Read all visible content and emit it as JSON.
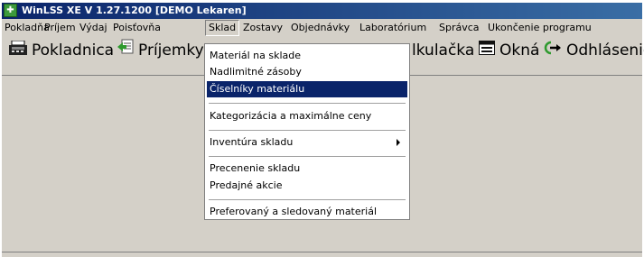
{
  "window": {
    "title": "WinLSS XE V 1.27.1200  [DEMO Lekaren]"
  },
  "menubar": {
    "items": [
      {
        "label": "Pokladňa"
      },
      {
        "label": "Príjem"
      },
      {
        "label": "Výdaj"
      },
      {
        "label": "Poisťovňa"
      },
      {
        "label": "Sklad",
        "open": true
      },
      {
        "label": "Zostavy"
      },
      {
        "label": "Objednávky"
      },
      {
        "label": "Laboratórium"
      },
      {
        "label": "Správca"
      },
      {
        "label": "Ukončenie programu"
      }
    ]
  },
  "toolbar": {
    "items": [
      {
        "label": "Pokladnica",
        "icon": "cash-register-icon"
      },
      {
        "label": "Príjemky",
        "icon": "receipt-icon"
      },
      {
        "label": "lkulačka",
        "icon": "calculator-icon"
      },
      {
        "label": "Okná",
        "icon": "window-icon"
      },
      {
        "label": "Odhlásenie",
        "icon": "logout-arrow-icon"
      }
    ]
  },
  "dropdown": {
    "groups": [
      [
        {
          "label": "Materiál na sklade"
        },
        {
          "label": "Nadlimitné zásoby"
        },
        {
          "label": "Číselníky materiálu",
          "selected": true
        }
      ],
      [
        {
          "label": "Kategorizácia a maximálne ceny"
        }
      ],
      [
        {
          "label": "Inventúra skladu",
          "submenu": true
        }
      ],
      [
        {
          "label": "Precenenie skladu"
        },
        {
          "label": "Predajné akcie"
        }
      ],
      [
        {
          "label": "Preferovaný a sledovaný materiál"
        }
      ]
    ]
  },
  "colors": {
    "titlebar": "#0a246a",
    "selection": "#0a246a",
    "face": "#d4d0c8",
    "icon_green": "#3c9a3c"
  }
}
